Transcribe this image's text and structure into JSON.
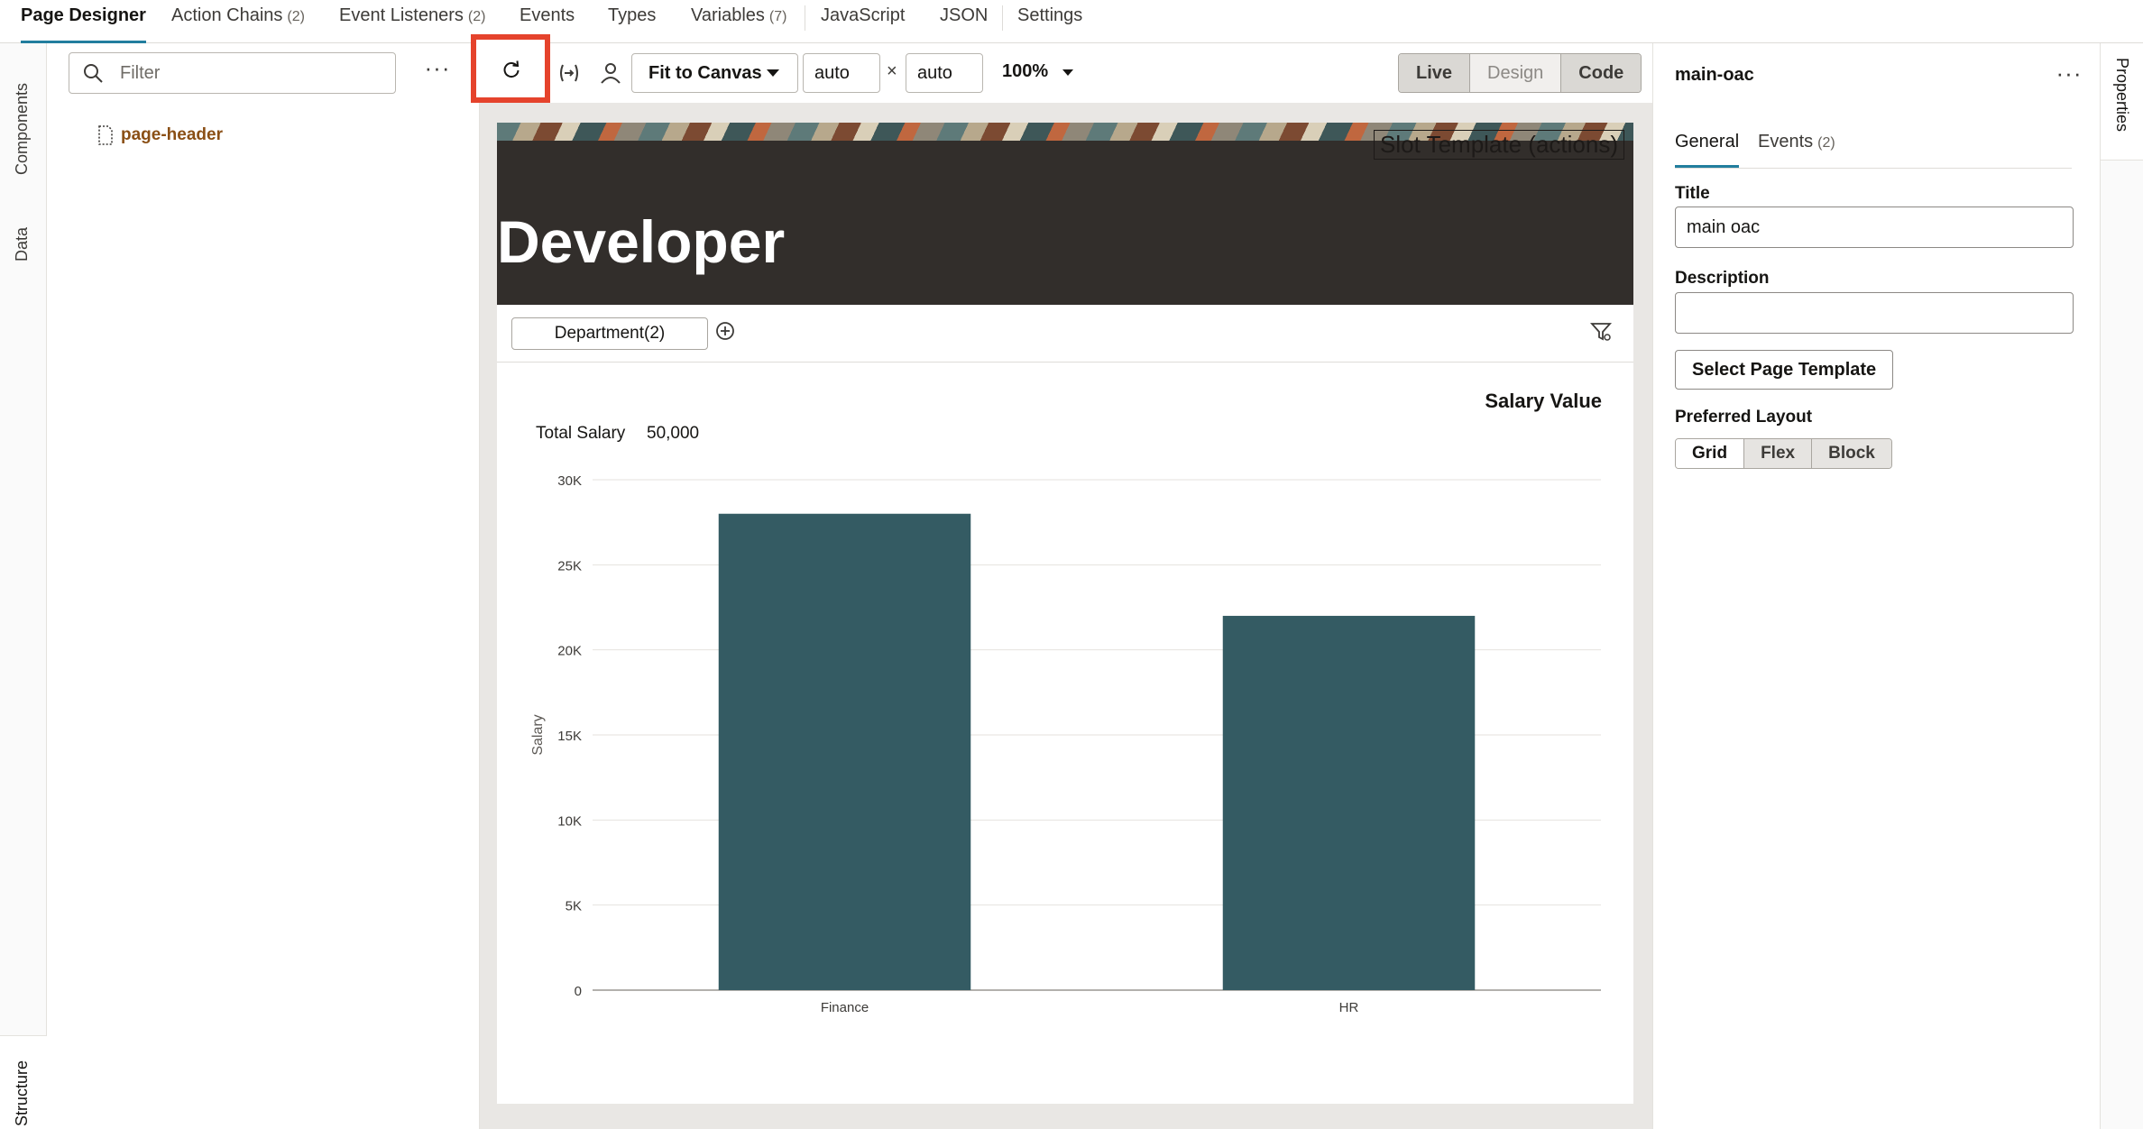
{
  "top_tabs": [
    {
      "label": "Page Designer",
      "count": ""
    },
    {
      "label": "Action Chains",
      "count": "(2)"
    },
    {
      "label": "Event Listeners",
      "count": "(2)"
    },
    {
      "label": "Events",
      "count": ""
    },
    {
      "label": "Types",
      "count": ""
    },
    {
      "label": "Variables",
      "count": "(7)"
    },
    {
      "label": "JavaScript",
      "count": ""
    },
    {
      "label": "JSON",
      "count": ""
    },
    {
      "label": "Settings",
      "count": ""
    }
  ],
  "left_rail": {
    "components": "Components",
    "data": "Data",
    "structure": "Structure"
  },
  "components": {
    "filter_placeholder": "Filter",
    "more": "···",
    "tree": [
      {
        "label": "page-header"
      }
    ]
  },
  "toolbar": {
    "fit_label": "Fit to Canvas",
    "width_value": "auto",
    "height_value": "auto",
    "times": "×",
    "zoom": "100%",
    "modes": [
      "Live",
      "Design",
      "Code"
    ],
    "highlight_color": "#e5432c"
  },
  "canvas": {
    "slot_label": "Slot Template (actions)",
    "header_title": "Developer",
    "filter_chip": "Department(2)"
  },
  "chart_data": {
    "type": "bar",
    "title": "Salary Value",
    "summary_label": "Total Salary",
    "summary_value": "50,000",
    "ylabel": "Salary",
    "xlabel": "",
    "categories": [
      "Finance",
      "HR"
    ],
    "values": [
      28000,
      22000
    ],
    "ylim": [
      0,
      30000
    ],
    "yticks": [
      "0",
      "5K",
      "10K",
      "15K",
      "20K",
      "25K",
      "30K"
    ],
    "bar_color": "#345b63",
    "grid": true
  },
  "properties": {
    "title": "main-oac",
    "more": "···",
    "tabs": [
      {
        "label": "General",
        "count": ""
      },
      {
        "label": "Events",
        "count": "(2)"
      }
    ],
    "title_label": "Title",
    "title_value": "main oac",
    "description_label": "Description",
    "description_value": "",
    "template_button": "Select Page Template",
    "layout_label": "Preferred Layout",
    "layout_options": [
      "Grid",
      "Flex",
      "Block"
    ]
  },
  "right_rail": {
    "properties": "Properties"
  },
  "colors": {
    "accent": "#227e9e",
    "link": "#8a4f15",
    "header_bg": "#322e2b"
  }
}
